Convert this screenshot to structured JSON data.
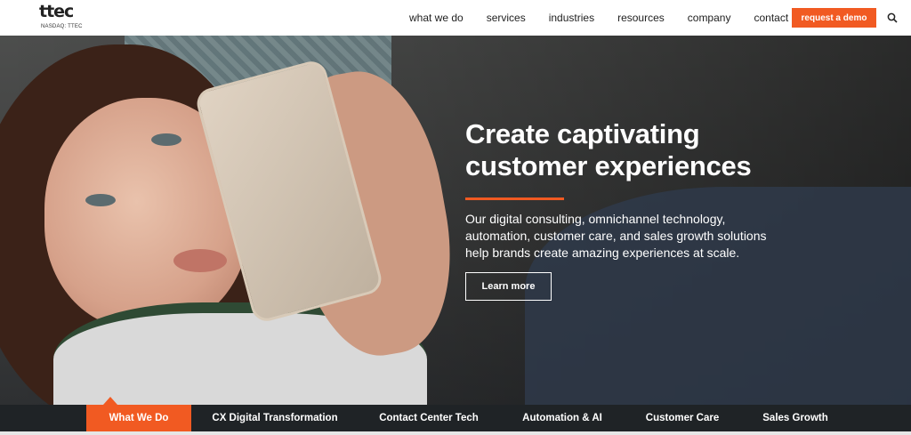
{
  "logo": {
    "word": "ttec",
    "subtext": "NASDAQ: TTEC"
  },
  "nav": {
    "links": [
      "what we do",
      "services",
      "industries",
      "resources",
      "company",
      "contact"
    ],
    "cta": "request a demo",
    "search_icon": "search-icon"
  },
  "hero": {
    "title_line1": "Create captivating",
    "title_line2": "customer experiences",
    "description": "Our digital consulting, omnichannel technology, automation, customer care, and sales growth solutions help brands create amazing experiences at scale.",
    "button": "Learn more"
  },
  "tabs": [
    {
      "label": "What We Do",
      "active": true
    },
    {
      "label": "CX Digital Transformation",
      "active": false
    },
    {
      "label": "Contact Center Tech",
      "active": false
    },
    {
      "label": "Automation & AI",
      "active": false
    },
    {
      "label": "Customer Care",
      "active": false
    },
    {
      "label": "Sales Growth",
      "active": false
    }
  ],
  "colors": {
    "accent": "#f15a22",
    "tabbar": "#1f2326"
  }
}
